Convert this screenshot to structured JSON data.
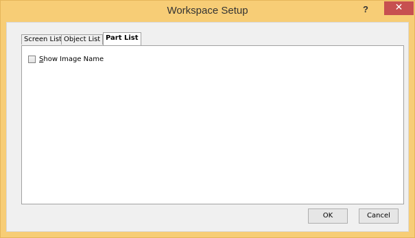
{
  "window": {
    "title": "Workspace Setup",
    "help_label": "?",
    "close_label": "✕",
    "frame_color": "#f7cd76",
    "close_color": "#c75050"
  },
  "tabs": [
    {
      "label": "Screen List",
      "active": false
    },
    {
      "label": "Object List",
      "active": false
    },
    {
      "label": "Part List",
      "active": true
    }
  ],
  "panel": {
    "show_image_name": {
      "mnemonic": "S",
      "label_rest": "how Image Name",
      "checked": false
    }
  },
  "buttons": {
    "ok_label": "OK",
    "cancel_label": "Cancel"
  }
}
